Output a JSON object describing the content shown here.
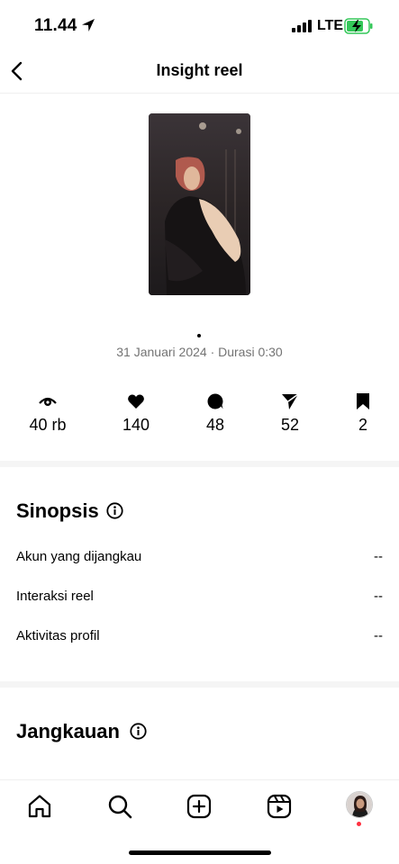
{
  "status_bar": {
    "time": "11.44",
    "network": "LTE"
  },
  "header": {
    "title": "Insight reel",
    "back_icon": "chevron-left-icon"
  },
  "reel": {
    "date_duration": "31 Januari 2024 · Durasi 0:30"
  },
  "stats": [
    {
      "icon": "eye-icon",
      "value": "40 rb"
    },
    {
      "icon": "heart-icon",
      "value": "140"
    },
    {
      "icon": "comment-icon",
      "value": "48"
    },
    {
      "icon": "share-icon",
      "value": "52"
    },
    {
      "icon": "bookmark-icon",
      "value": "2"
    }
  ],
  "sinopsis": {
    "title": "Sinopsis",
    "rows": [
      {
        "label": "Akun yang dijangkau",
        "value": "--"
      },
      {
        "label": "Interaksi reel",
        "value": "--"
      },
      {
        "label": "Aktivitas profil",
        "value": "--"
      }
    ]
  },
  "jangkauan": {
    "title": "Jangkauan"
  },
  "tabbar": [
    "home-icon",
    "search-icon",
    "create-icon",
    "reels-icon",
    "profile-avatar"
  ],
  "colors": {
    "muted_text": "#737373",
    "notification": "#ff3040",
    "battery_fill": "#34c759"
  }
}
